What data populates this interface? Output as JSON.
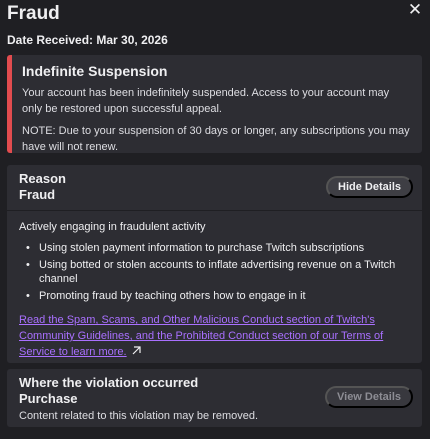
{
  "header": {
    "title": "Fraud",
    "date_received": "Date Received: Mar 30, 2026",
    "close_icon": "close-icon"
  },
  "suspension": {
    "title": "Indefinite Suspension",
    "body": "Your account has been indefinitely suspended. Access to your account may only be restored upon successful appeal.",
    "note": "NOTE: Due to your suspension of 30 days or longer, any subscriptions you may have will not renew.",
    "accent_color": "#e24c4f"
  },
  "reason": {
    "heading": "Reason",
    "value": "Fraud",
    "hide_button": "Hide Details",
    "description": "Actively engaging in fraudulent activity",
    "bullets": [
      "Using stolen payment information to purchase Twitch subscriptions",
      "Using botted or stolen accounts to inflate advertising revenue on a Twitch channel",
      "Promoting fraud by teaching others how to engage in it"
    ],
    "link_text": "Read the Spam, Scams, and Other Malicious Conduct section of Twitch's Community Guidelines, and the Prohibited Conduct section of our Terms of Service to learn more.",
    "link_icon": "external-link-icon",
    "link_color": "#a970ff"
  },
  "violation": {
    "heading": "Where the violation occurred",
    "value": "Purchase",
    "note": "Content related to this violation may be removed.",
    "view_button": "View Details"
  }
}
